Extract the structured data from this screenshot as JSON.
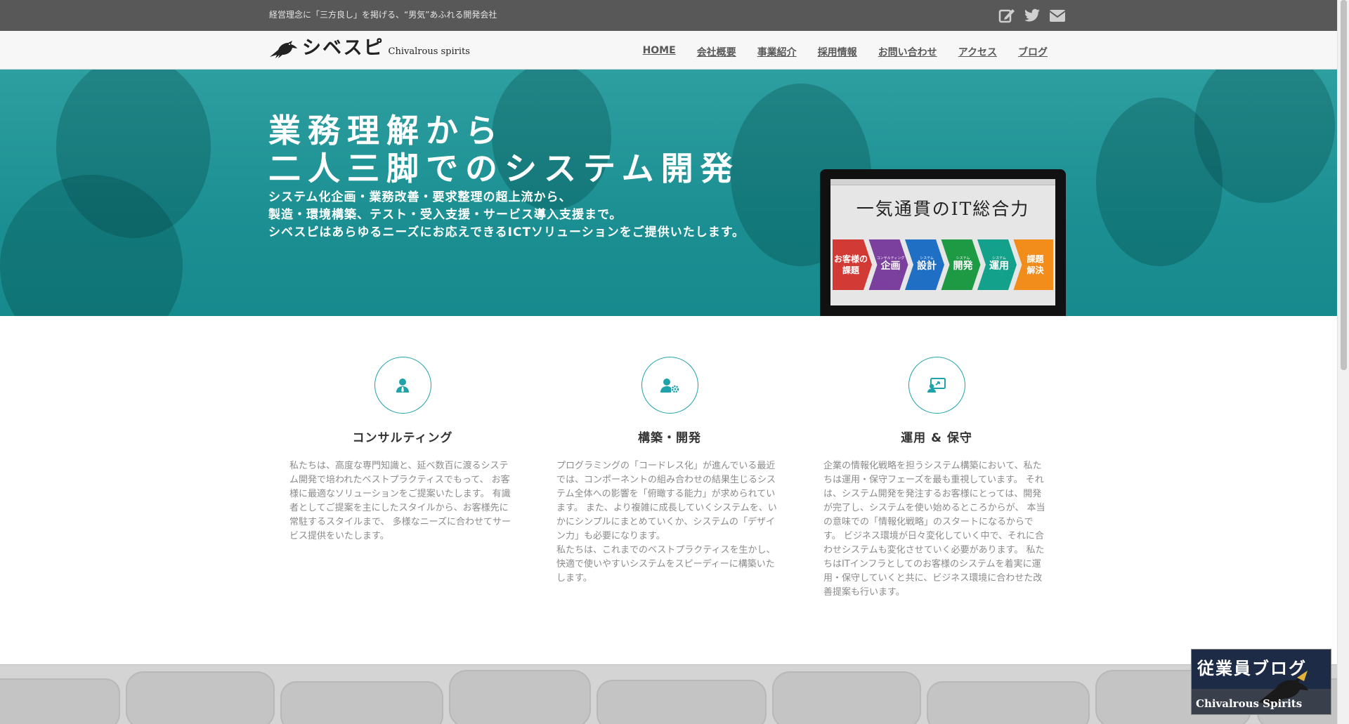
{
  "header": {
    "tagline": "経営理念に「三方良し」を掲げる、“男気”あふれる開発会社",
    "icons": [
      "edit-icon",
      "twitter-icon",
      "mail-icon"
    ]
  },
  "brand": {
    "name_jp": "シベスピ",
    "name_en": "Chivalrous spirits"
  },
  "nav": {
    "items": [
      "HOME",
      "会社概要",
      "事業紹介",
      "採用情報",
      "お問い合わせ",
      "アクセス",
      "ブログ"
    ]
  },
  "hero": {
    "title_line1": "業務理解から",
    "title_line2": "二人三脚でのシステム開発",
    "sub_line1": "システム化企画・業務改善・要求整理の超上流から、",
    "sub_line2": "製造・環境構築、テスト・受入支援・サービス導入支援まで。",
    "sub_line3": "シベスピはあらゆるニーズにお応えできるICTソリューションをご提供いたします。",
    "monitor_heading": "一気通貫のIT総合力",
    "flow_steps": [
      {
        "label_top": "お客様の",
        "label": "課題",
        "color": "#d23a35"
      },
      {
        "small": "コンサルティング",
        "label": "企画",
        "color": "#7b3f9e"
      },
      {
        "small": "システム",
        "label": "設計",
        "color": "#1f6fc4"
      },
      {
        "small": "システム",
        "label": "開発",
        "color": "#1e9a45"
      },
      {
        "small": "システム",
        "label": "運用",
        "color": "#13a18c"
      },
      {
        "label_top": "課題",
        "label": "解決",
        "color": "#f28c1b"
      }
    ],
    "accent_color": "#1b9295"
  },
  "services": [
    {
      "icon": "user-tie-icon",
      "title": "コンサルティング",
      "text": [
        "私たちは、高度な専門知識と、延べ数百に渡るシステム開発で培われたベストプラクティスでもって、 お客様に最適なソリューションをご提案いたします。 有識者としてご提案を主にしたスタイルから、お客様先に常駐するスタイルまで、 多様なニーズに合わせてサービス提供をいたします。"
      ]
    },
    {
      "icon": "user-gear-icon",
      "title": "構築・開発",
      "text": [
        "プログラミングの「コードレス化」が進んでいる最近では、コンポーネントの組み合わせの結果生じるシステム全体への影響を「俯瞰する能力」が求められています。 また、より複雑に成長していくシステムを、いかにシンプルにまとめていくか、システムの「デザイン力」も必要になります。",
        "私たちは、これまでのベストプラクティスを生かし、快適で使いやすいシステムをスピーディーに構築いたします。"
      ]
    },
    {
      "icon": "monitor-user-icon",
      "title": "運用 & 保守",
      "text": [
        "企業の情報化戦略を担うシステム構築において、私たちは運用・保守フェーズを最も重視しています。 それは、システム開発を発注するお客様にとっては、開発が完了し、システムを使い始めるところからが、 本当の意味での「情報化戦略」のスタートになるからです。 ビジネス環境が日々変化していく中で、それに合わせシステムも変化させていく必要があります。 私たちはITインフラとしてのお客様のシステムを着実に運用・保守していくと共に、ビジネス環境に合わせた改善提案も行います。"
      ]
    }
  ],
  "blog_banner": {
    "title": "従業員ブログ",
    "subtitle": "Chivalrous Spirits"
  }
}
